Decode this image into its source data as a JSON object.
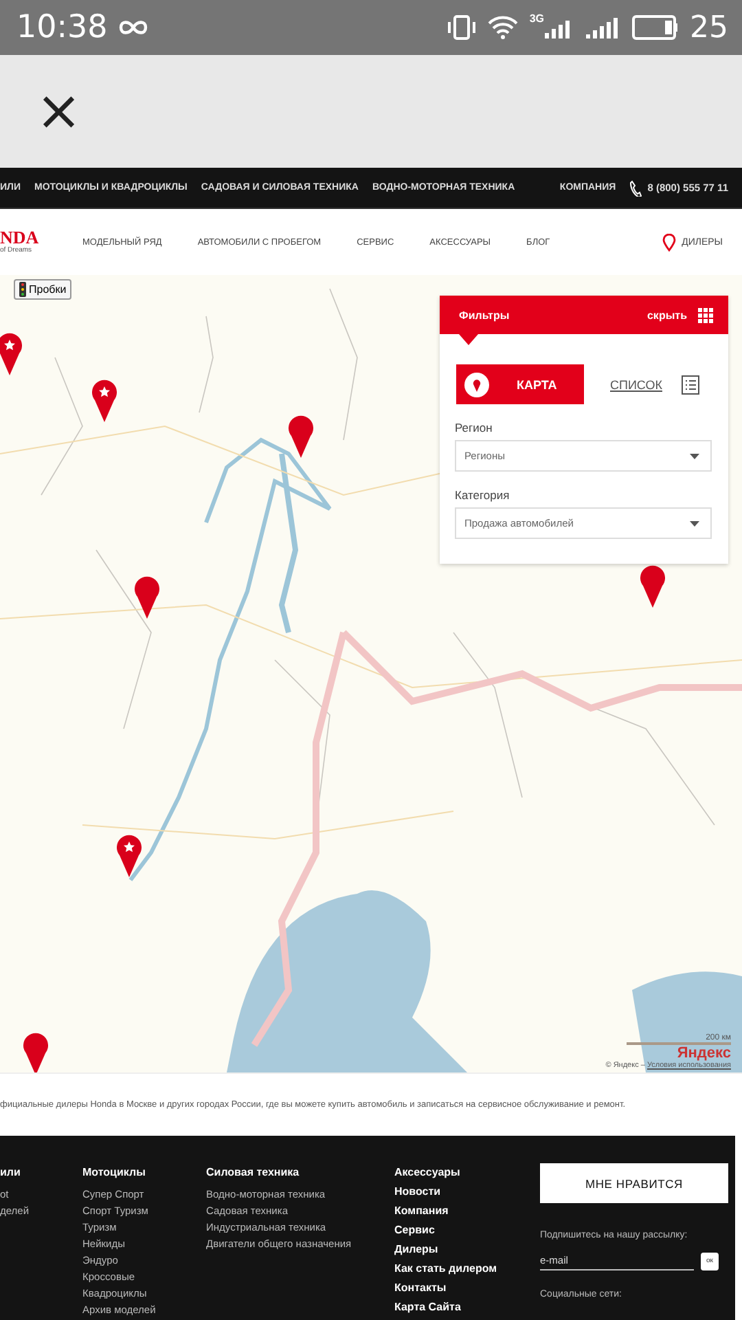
{
  "status_bar": {
    "time": "10:38",
    "network": "3G",
    "battery": "25"
  },
  "browser_bar": {
    "close": "×"
  },
  "top_nav": {
    "items": [
      "ИЛИ",
      "МОТОЦИКЛЫ И КВАДРОЦИКЛЫ",
      "САДОВАЯ И СИЛОВАЯ ТЕХНИКА",
      "ВОДНО-МОТОРНАЯ ТЕХНИКА"
    ],
    "company": "КОМПАНИЯ",
    "phone": "8 (800) 555 77 11"
  },
  "header": {
    "logo": "NDA",
    "tagline": "of Dreams",
    "nav": [
      "МОДЕЛЬНЫЙ РЯД",
      "АВТОМОБИЛИ С ПРОБЕГОМ",
      "СЕРВИС",
      "АКСЕССУАРЫ",
      "БЛОГ"
    ],
    "dealers": "ДИЛЕРЫ"
  },
  "map": {
    "traffic_button": "Пробки",
    "markers": [
      {
        "kind": "star"
      },
      {
        "kind": "star"
      },
      {
        "kind": "plain"
      },
      {
        "kind": "plain"
      },
      {
        "kind": "plain"
      },
      {
        "kind": "star"
      },
      {
        "kind": "plain"
      }
    ],
    "scale": "200 км",
    "brand": "Яндекс",
    "copyright": "© Яндекс –",
    "terms_link": "Условия использования"
  },
  "filters": {
    "title": "Фильтры",
    "hide": "скрыть",
    "views": [
      {
        "label": "КАРТА",
        "selected": true
      },
      {
        "label": "СПИСОК",
        "selected": false
      }
    ],
    "fields": [
      {
        "label": "Регион",
        "value": "Регионы"
      },
      {
        "label": "Категория",
        "value": "Продажа автомобилей"
      }
    ]
  },
  "description": "фициальные дилеры Honda в Москве и других городах России, где вы можете купить автомобиль и записаться на сервисное обслуживание и ремонт.",
  "footer": {
    "columns": [
      {
        "heading": "или",
        "items": [
          "ot",
          "делей"
        ]
      },
      {
        "heading": "Мотоциклы",
        "items": [
          "Супер Спорт",
          "Спорт Туризм",
          "Туризм",
          "Нейкиды",
          "Эндуро",
          "Кроссовые",
          "Квадроциклы",
          "Архив моделей"
        ]
      },
      {
        "heading": "Силовая техника",
        "items": [
          "Водно-моторная техника",
          "Садовая техника",
          "Индустриальная техника",
          "Двигатели общего назначения"
        ]
      }
    ],
    "links": [
      "Аксессуары",
      "Новости",
      "Компания",
      "Сервис",
      "Дилеры",
      "Как стать дилером",
      "Контакты",
      "Карта Сайта"
    ],
    "like_button": "МНЕ НРАВИТСЯ",
    "subscribe_label": "Подпишитесь на нашу рассылку:",
    "email_placeholder": "e-mail",
    "ok": "ок",
    "social_label": "Социальные сети:"
  }
}
